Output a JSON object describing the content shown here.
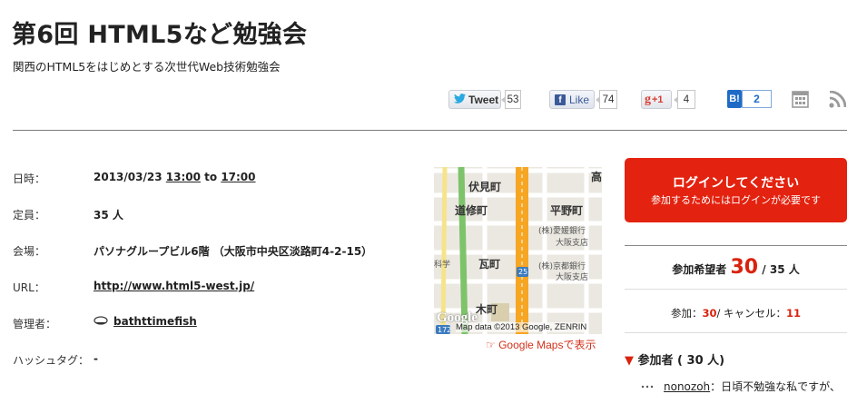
{
  "event": {
    "title": "第6回 HTML5など勉強会",
    "subtitle": "関西のHTML5をはじめとする次世代Web技術勉強会"
  },
  "share": {
    "tweet_label": "Tweet",
    "tweet_count": "53",
    "like_label": "Like",
    "like_count": "74",
    "gplus_label": "+1",
    "gplus_count": "4",
    "hatena_label": "B!",
    "hatena_count": "2",
    "icons": [
      "twitter-icon",
      "facebook-icon",
      "google-plus-icon",
      "hatena-bookmark-icon",
      "calendar-icon",
      "rss-icon"
    ]
  },
  "details": {
    "date_label": "日時：",
    "date_value": "2013/03/23",
    "time_start": "13:00",
    "time_to": "to",
    "time_end": "17:00",
    "capacity_label": "定員：",
    "capacity_value": "35 人",
    "venue_label": "会場：",
    "venue_value": "パソナグループビル6階 （大阪市中央区淡路町4-2-15）",
    "url_label": "URL：",
    "url_value": "http://www.html5-west.jp/",
    "admin_label": "管理者：",
    "admin_value": "bathttimefish",
    "hashtag_label": "ハッシュタグ：",
    "hashtag_value": "-"
  },
  "map": {
    "labels": [
      "伏見町",
      "道修町",
      "平野町",
      "(株)愛媛銀行",
      "大阪支店",
      "瓦町",
      "(株)京都銀行",
      "大阪支店",
      "木町",
      "科学",
      "高",
      "25",
      "172"
    ],
    "attribution": "Map data ©2013 Google, ZENRIN",
    "logo": "Google",
    "link_text": "☞ Google Mapsで表示"
  },
  "sidebar": {
    "login_title": "ログインしてください",
    "login_sub": "参加するためにはログインが必要です",
    "applicants_label": "参加希望者",
    "applicants_count": "30",
    "applicants_cap": "/ 35 人",
    "attend_label": "参加：",
    "attend_count": "30",
    "cancel_label": "/ キャンセル：",
    "cancel_count": "11",
    "participants_title": "参加者 ( 30 人)",
    "first_participant": "nonozoh",
    "first_participant_comment": "：日頃不勉強な私ですが、"
  },
  "colors": {
    "accent": "#e3220f",
    "link_red": "#d2301a"
  }
}
